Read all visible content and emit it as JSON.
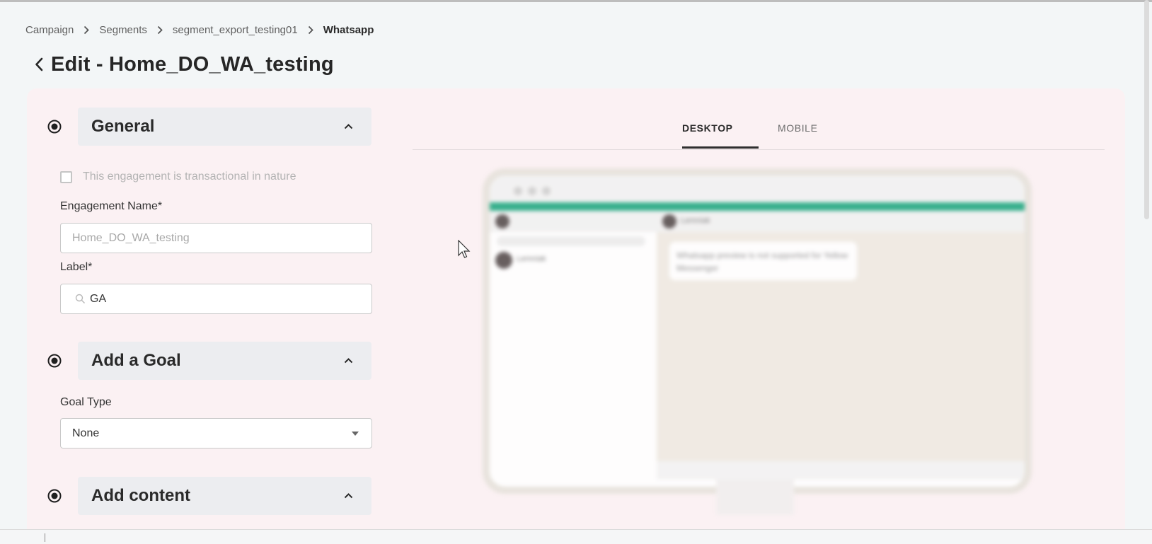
{
  "breadcrumb": [
    "Campaign",
    "Segments",
    "segment_export_testing01",
    "Whatsapp"
  ],
  "page": {
    "title": "Edit - Home_DO_WA_testing"
  },
  "general": {
    "title": "General",
    "transactional_label": "This engagement is transactional in nature",
    "engagement_name_label": "Engagement Name*",
    "engagement_name_placeholder": "Home_DO_WA_testing",
    "label_label": "Label*",
    "label_value": "GA"
  },
  "goal": {
    "title": "Add a Goal",
    "goal_type_label": "Goal Type",
    "goal_type_value": "None"
  },
  "content": {
    "title": "Add content"
  },
  "preview": {
    "tabs": [
      "DESKTOP",
      "MOBILE"
    ],
    "active_tab": "DESKTOP",
    "contact_name": "Lemniak",
    "message": "Whatsapp preview is not supported for Yellow Messenger"
  },
  "colors": {
    "accent_green": "#23a982",
    "card_bg": "#fbf1f3",
    "page_bg": "#f3f6f7"
  }
}
